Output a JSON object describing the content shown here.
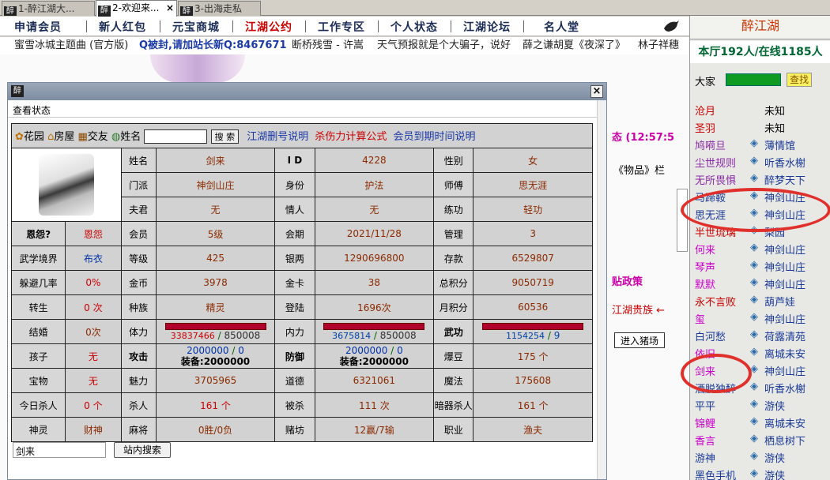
{
  "tabs": [
    {
      "label": "1-醉江湖大...",
      "icon": "zui-icon",
      "active": false
    },
    {
      "label": "2-欢迎来...",
      "icon": "zui-icon",
      "active": true,
      "close": "×"
    },
    {
      "label": "3-出海走私",
      "icon": "zui-icon",
      "active": false
    }
  ],
  "nav": [
    "申请会员",
    "新人红包",
    "元宝商城",
    "江湖公约",
    "工作专区",
    "个人状态",
    "江湖论坛",
    "名人堂"
  ],
  "marquee": [
    "蜜雪冰城主题曲 (官方版)",
    "Q被封,请加站长新Q:8467671",
    "断桥残雪 - 许嵩",
    "天气预报就是个大骗子，说好",
    "薛之谦胡夏《夜深了》",
    "林子祥穗"
  ],
  "bg": {
    "status_text": "态 (12:57:5",
    "item_text": "《物品》栏",
    "policy_text": "贴政策",
    "noble_text": "江湖贵族 ←",
    "pig_button": "进入猪场"
  },
  "dialog": {
    "title_icon": "醉",
    "close": "×",
    "subtitle": "查看状态",
    "links": {
      "garden": "花园",
      "house": "房屋",
      "friends": "交友",
      "name_label": "姓名",
      "search_btn": "搜 索",
      "delete_info": "江湖删号说明",
      "damage_formula": "杀伤力计算公式",
      "expire_info": "会员到期时间说明"
    },
    "profile": {
      "name_l": "姓名",
      "name": "剑来",
      "id_l": "I D",
      "id": "4228",
      "gender_l": "性别",
      "gender": "女",
      "sect_l": "门派",
      "sect": "神剑山庄",
      "role_l": "身份",
      "role": "护法",
      "master_l": "师傅",
      "master": "思无涯",
      "spouse_l": "夫君",
      "spouse": "无",
      "lover_l": "情人",
      "lover": "无",
      "train_l": "练功",
      "train": "轻功",
      "grudge_l": "恩怨?",
      "grudge": "恩怨",
      "member_l": "会员",
      "member": "5级",
      "period_l": "会期",
      "period": "2021/11/28",
      "manage_l": "管理",
      "manage": "3",
      "realm_l": "武学境界",
      "realm": "布衣",
      "level_l": "等级",
      "level": "425",
      "silver_l": "银两",
      "silver": "1290696800",
      "deposit_l": "存款",
      "deposit": "6529807",
      "dodge_l": "躲避几率",
      "dodge": "0%",
      "gold_l": "金币",
      "gold": "3978",
      "card_l": "金卡",
      "card": "38",
      "score_l": "总积分",
      "score": "9050719",
      "rebirth_l": "转生",
      "rebirth": "0 次",
      "race_l": "种族",
      "race": "精灵",
      "login_l": "登陆",
      "login": "1696次",
      "mscore_l": "月积分",
      "mscore": "60536",
      "marry_l": "结婚",
      "marry": "0次",
      "hp_l": "体力",
      "hp": "33837466",
      "hp_max": "850008",
      "mp_l": "内力",
      "mp": "3675814",
      "mp_max": "850008",
      "martial_l": "武功",
      "martial": "1154254",
      "martial_max": "9",
      "child_l": "孩子",
      "child": "无",
      "atk_l": "攻击",
      "atk": "2000000",
      "atk2": "0",
      "atk_eq": "装备:2000000",
      "def_l": "防御",
      "def": "2000000",
      "def2": "0",
      "def_eq": "装备:2000000",
      "bean_l": "爆豆",
      "bean": "175 个",
      "treasure_l": "宝物",
      "treasure": "无",
      "charm_l": "魅力",
      "charm": "3705965",
      "virtue_l": "道德",
      "virtue": "6321061",
      "magic_l": "魔法",
      "magic": "175608",
      "kill_today_l": "今日杀人",
      "kill_today": "0 个",
      "kill_l": "杀人",
      "kill": "161 个",
      "killed_l": "被杀",
      "killed": "111 次",
      "hidden_l": "暗器杀人",
      "hidden": "161 个",
      "spirit_l": "神灵",
      "spirit": "财神",
      "mahjong_l": "麻将",
      "mahjong": "0胜/0负",
      "casino_l": "赌坊",
      "casino": "12赢/7输",
      "job_l": "职业",
      "job": "渔夫"
    },
    "search_value": "剑来",
    "site_search": "站内搜索"
  },
  "right": {
    "title": "醉江湖",
    "stats": "本厅192人/在线1185人",
    "all_label": "大家",
    "find_btn": "查找",
    "players": [
      {
        "name": "沧月",
        "group": "未知",
        "color": "#cc0000",
        "gicon": false
      },
      {
        "name": "圣羽",
        "group": "未知",
        "color": "#cc0000",
        "gicon": false
      },
      {
        "name": "鸠嗬旦",
        "group": "薄情馆",
        "color": "#8a2aa8",
        "gicon": true
      },
      {
        "name": "尘世规则",
        "group": "听香水榭",
        "color": "#8a2aa8",
        "gicon": true
      },
      {
        "name": "无所畏惧",
        "group": "醉梦天下",
        "color": "#8a2aa8",
        "gicon": true
      },
      {
        "name": "马蹄鞍",
        "group": "神剑山庄",
        "color": "#1a3a99",
        "gicon": true
      },
      {
        "name": "思无涯",
        "group": "神剑山庄",
        "color": "#1a3a99",
        "gicon": true
      },
      {
        "name": "半世琉璃",
        "group": "梨园",
        "color": "#cc0000",
        "gicon": true
      },
      {
        "name": "何来",
        "group": "神剑山庄",
        "color": "#cc00cc",
        "gicon": true
      },
      {
        "name": "琴声",
        "group": "神剑山庄",
        "color": "#cc00cc",
        "gicon": true
      },
      {
        "name": "默默",
        "group": "神剑山庄",
        "color": "#cc00cc",
        "gicon": true
      },
      {
        "name": "永不言败",
        "group": "葫芦娃",
        "color": "#cc0000",
        "gicon": true
      },
      {
        "name": "玺",
        "group": "神剑山庄",
        "color": "#cc00cc",
        "gicon": true
      },
      {
        "name": "白河愁",
        "group": "荷露清苑",
        "color": "#1a3a99",
        "gicon": true
      },
      {
        "name": "依旧",
        "group": "离城未安",
        "color": "#cc00cc",
        "gicon": true
      },
      {
        "name": "剑来",
        "group": "神剑山庄",
        "color": "#cc00cc",
        "gicon": true
      },
      {
        "name": "洒脱独醉",
        "group": "听香水榭",
        "color": "#1a3a99",
        "gicon": true
      },
      {
        "name": "平平",
        "group": "游侠",
        "color": "#1a3a99",
        "gicon": true
      },
      {
        "name": "锦鲤",
        "group": "离城未安",
        "color": "#cc00cc",
        "gicon": true
      },
      {
        "name": "香言",
        "group": "栖息树下",
        "color": "#cc00cc",
        "gicon": true
      },
      {
        "name": "游神",
        "group": "游侠",
        "color": "#1a3a99",
        "gicon": true
      },
      {
        "name": "黑色手机",
        "group": "游侠",
        "color": "#1a3a99",
        "gicon": true
      }
    ]
  }
}
